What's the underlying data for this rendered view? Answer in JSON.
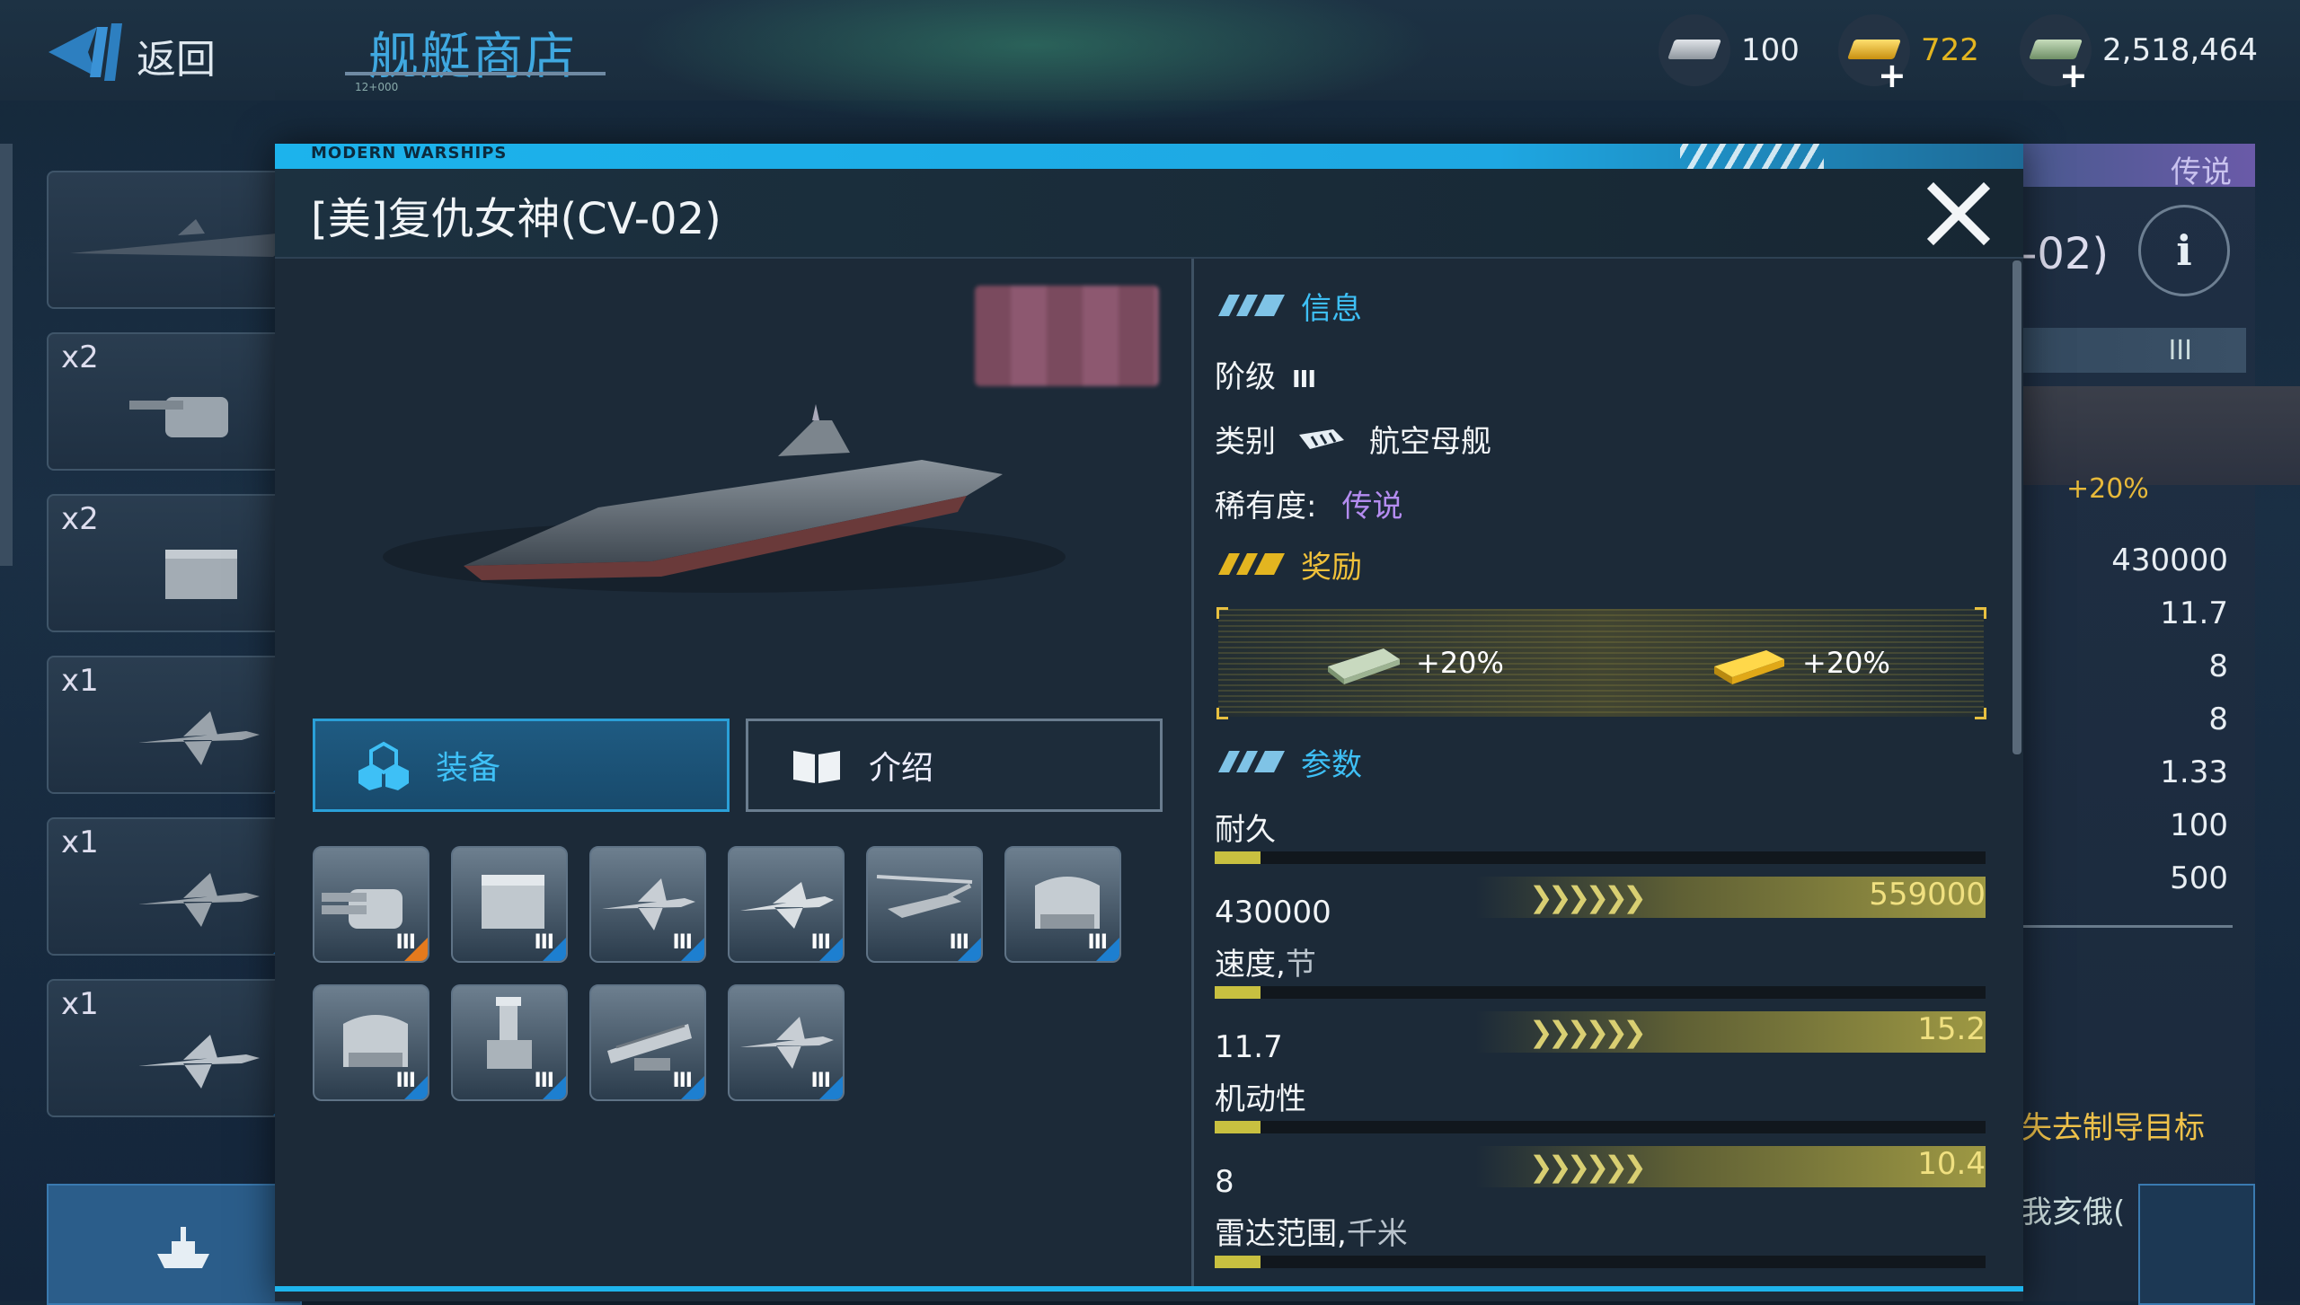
{
  "header": {
    "back_label": "返回",
    "shop_title": "舰艇商店",
    "shop_subtitle": "12+000"
  },
  "currencies": [
    {
      "name": "silver",
      "value": "100",
      "icon": "silver-bar-icon",
      "color": "#b8bfc6"
    },
    {
      "name": "gold",
      "value": "722",
      "icon": "gold-bar-icon",
      "color": "#e3b520"
    },
    {
      "name": "dollars",
      "value": "2,518,464",
      "icon": "dollar-bill-icon",
      "color": "#9bbf92"
    }
  ],
  "left_list": {
    "slots": [
      {
        "count": "",
        "icon": "warship-thumb-icon"
      },
      {
        "count": "x2",
        "icon": "cannon-turret-icon"
      },
      {
        "count": "x2",
        "icon": "missile-launcher-icon"
      },
      {
        "count": "x1",
        "icon": "jet-fighter-icon"
      },
      {
        "count": "x1",
        "icon": "jet-fighter-icon"
      },
      {
        "count": "x1",
        "icon": "jet-fighter-icon"
      }
    ]
  },
  "background_panel": {
    "rarity_tab": "传说",
    "title_fragment": "-02)",
    "tier": "III",
    "bonus": "+20%",
    "values": [
      "430000",
      "11.7",
      "8",
      "8",
      "1.33",
      "100",
      "500"
    ],
    "hint": "失去制导目标",
    "hint2": "我亥俄("
  },
  "modal": {
    "brand": "MODERN WARSHIPS",
    "title": "[美]复仇女神(CV-02)",
    "tabs": {
      "equipment": "装备",
      "intro": "介绍"
    },
    "equipment": [
      {
        "icon": "naval-gun-icon",
        "tier": "III",
        "accent": "orange"
      },
      {
        "icon": "missile-box-launcher-icon",
        "tier": "III",
        "accent": "blue"
      },
      {
        "icon": "stealth-fighter-icon",
        "tier": "III",
        "accent": "blue"
      },
      {
        "icon": "jet-fighter-icon",
        "tier": "III",
        "accent": "blue"
      },
      {
        "icon": "attack-helicopter-icon",
        "tier": "III",
        "accent": "blue"
      },
      {
        "icon": "ciws-turret-icon",
        "tier": "III",
        "accent": "blue"
      },
      {
        "icon": "ciws-turret-icon",
        "tier": "III",
        "accent": "blue"
      },
      {
        "icon": "radar-mast-icon",
        "tier": "III",
        "accent": "blue"
      },
      {
        "icon": "rocket-launcher-icon",
        "tier": "III",
        "accent": "blue"
      },
      {
        "icon": "stealth-fighter-icon",
        "tier": "III",
        "accent": "blue"
      }
    ],
    "info": {
      "section_title": "信息",
      "tier_label": "阶级",
      "tier_value": "III",
      "type_label": "类别",
      "type_value": "航空母舰",
      "rarity_label": "稀有度:",
      "rarity_value": "传说",
      "rarity_color": "#b48cf0"
    },
    "reward": {
      "section_title": "奖励",
      "dollar_bonus": "+20%",
      "gold_bonus": "+20%"
    },
    "params": {
      "section_title": "参数",
      "stats": [
        {
          "label": "耐久",
          "unit": "",
          "current": "430000",
          "max": "559000",
          "fill": 0.06
        },
        {
          "label": "速度,",
          "unit": "节",
          "current": "11.7",
          "max": "15.2",
          "fill": 0.06
        },
        {
          "label": "机动性",
          "unit": "",
          "current": "8",
          "max": "10.4",
          "fill": 0.06
        },
        {
          "label": "雷达范围,",
          "unit": "千米",
          "current": "",
          "max": "",
          "fill": 0.06
        }
      ]
    }
  }
}
